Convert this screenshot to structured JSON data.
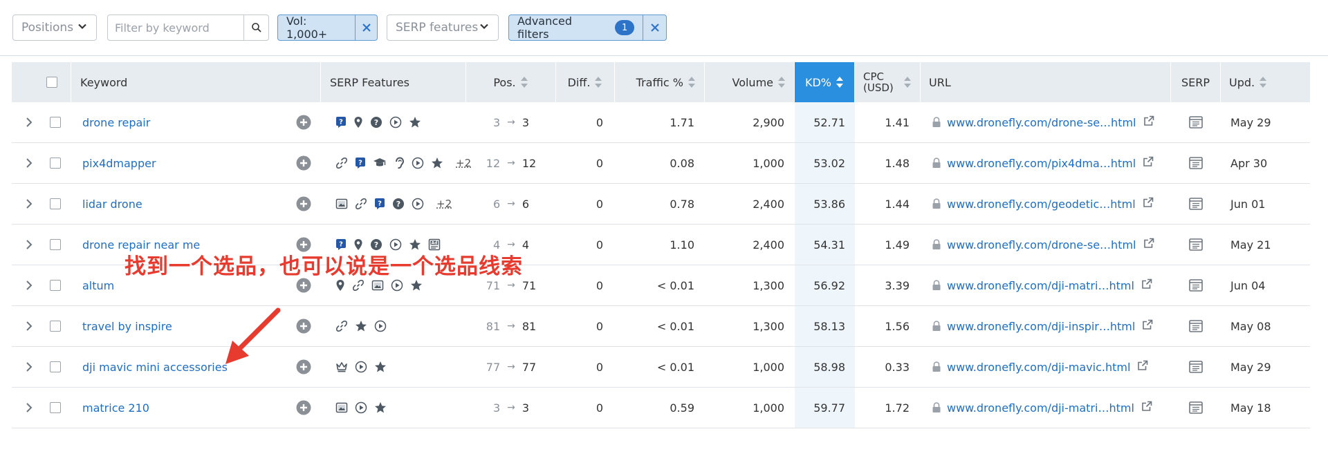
{
  "toolbar": {
    "positions_label": "Positions",
    "filter_placeholder": "Filter by keyword",
    "vol_chip_label": "Vol: 1,000+",
    "serp_features_label": "SERP features",
    "advanced_filters_label": "Advanced filters",
    "advanced_filters_count": "1"
  },
  "table": {
    "headers": {
      "keyword": "Keyword",
      "serp_features": "SERP Features",
      "pos": "Pos.",
      "diff": "Diff.",
      "traffic": "Traffic %",
      "volume": "Volume",
      "kd": "KD%",
      "cpc_line1": "CPC",
      "cpc_line2": "(USD)",
      "url": "URL",
      "serp": "SERP",
      "upd": "Upd."
    },
    "rows": [
      {
        "keyword": "drone repair",
        "features": [
          "faq",
          "pin",
          "question",
          "play",
          "star"
        ],
        "more": "",
        "pos_from": "3",
        "pos_to": "3",
        "diff": "0",
        "traffic": "1.71",
        "volume": "2,900",
        "kd": "52.71",
        "cpc": "1.41",
        "url": "www.dronefly.com/drone-se…html",
        "upd": "May 29"
      },
      {
        "keyword": "pix4dmapper",
        "features": [
          "link",
          "faq",
          "cap",
          "ear",
          "play",
          "star"
        ],
        "more": "+2",
        "pos_from": "12",
        "pos_to": "12",
        "diff": "0",
        "traffic": "0.08",
        "volume": "1,000",
        "kd": "53.02",
        "cpc": "1.48",
        "url": "www.dronefly.com/pix4dma…html",
        "upd": "Apr 30"
      },
      {
        "keyword": "lidar drone",
        "features": [
          "image",
          "link",
          "faq",
          "question",
          "play"
        ],
        "more": "+2",
        "pos_from": "6",
        "pos_to": "6",
        "diff": "0",
        "traffic": "0.78",
        "volume": "2,400",
        "kd": "53.86",
        "cpc": "1.44",
        "url": "www.dronefly.com/geodetic…html",
        "upd": "Jun 01"
      },
      {
        "keyword": "drone repair near me",
        "features": [
          "faq",
          "pin",
          "question",
          "play",
          "star",
          "ad"
        ],
        "more": "",
        "pos_from": "4",
        "pos_to": "4",
        "diff": "0",
        "traffic": "1.10",
        "volume": "2,400",
        "kd": "54.31",
        "cpc": "1.49",
        "url": "www.dronefly.com/drone-se…html",
        "upd": "May 21"
      },
      {
        "keyword": "altum",
        "features": [
          "pin",
          "link",
          "image",
          "play",
          "star"
        ],
        "more": "",
        "pos_from": "71",
        "pos_to": "71",
        "diff": "0",
        "traffic": "< 0.01",
        "volume": "1,300",
        "kd": "56.92",
        "cpc": "3.39",
        "url": "www.dronefly.com/dji-matri…html",
        "upd": "Jun 04"
      },
      {
        "keyword": "travel by inspire",
        "features": [
          "link",
          "star",
          "play"
        ],
        "more": "",
        "pos_from": "81",
        "pos_to": "81",
        "diff": "0",
        "traffic": "< 0.01",
        "volume": "1,300",
        "kd": "58.13",
        "cpc": "1.56",
        "url": "www.dronefly.com/dji-inspir…html",
        "upd": "May 08"
      },
      {
        "keyword": "dji mavic mini accessories",
        "features": [
          "crown",
          "play",
          "star"
        ],
        "more": "",
        "pos_from": "77",
        "pos_to": "77",
        "diff": "0",
        "traffic": "< 0.01",
        "volume": "1,000",
        "kd": "58.98",
        "cpc": "0.33",
        "url": "www.dronefly.com/dji-mavic.html",
        "upd": "May 29"
      },
      {
        "keyword": "matrice 210",
        "features": [
          "image",
          "play",
          "star"
        ],
        "more": "",
        "pos_from": "3",
        "pos_to": "3",
        "diff": "0",
        "traffic": "0.59",
        "volume": "1,000",
        "kd": "59.77",
        "cpc": "1.72",
        "url": "www.dronefly.com/dji-matri…html",
        "upd": "May 18"
      }
    ]
  },
  "annotation": {
    "text": "找到一个选品，也可以说是一个选品线索",
    "color": "#e63b2e"
  },
  "colors": {
    "link": "#1f6ec1",
    "sorted_header": "#2a8fde",
    "header_bg": "#e7ecf0",
    "chip_bg": "#cfe3f5",
    "chip_border": "#5d9ad6",
    "icon": "#4d5862"
  }
}
